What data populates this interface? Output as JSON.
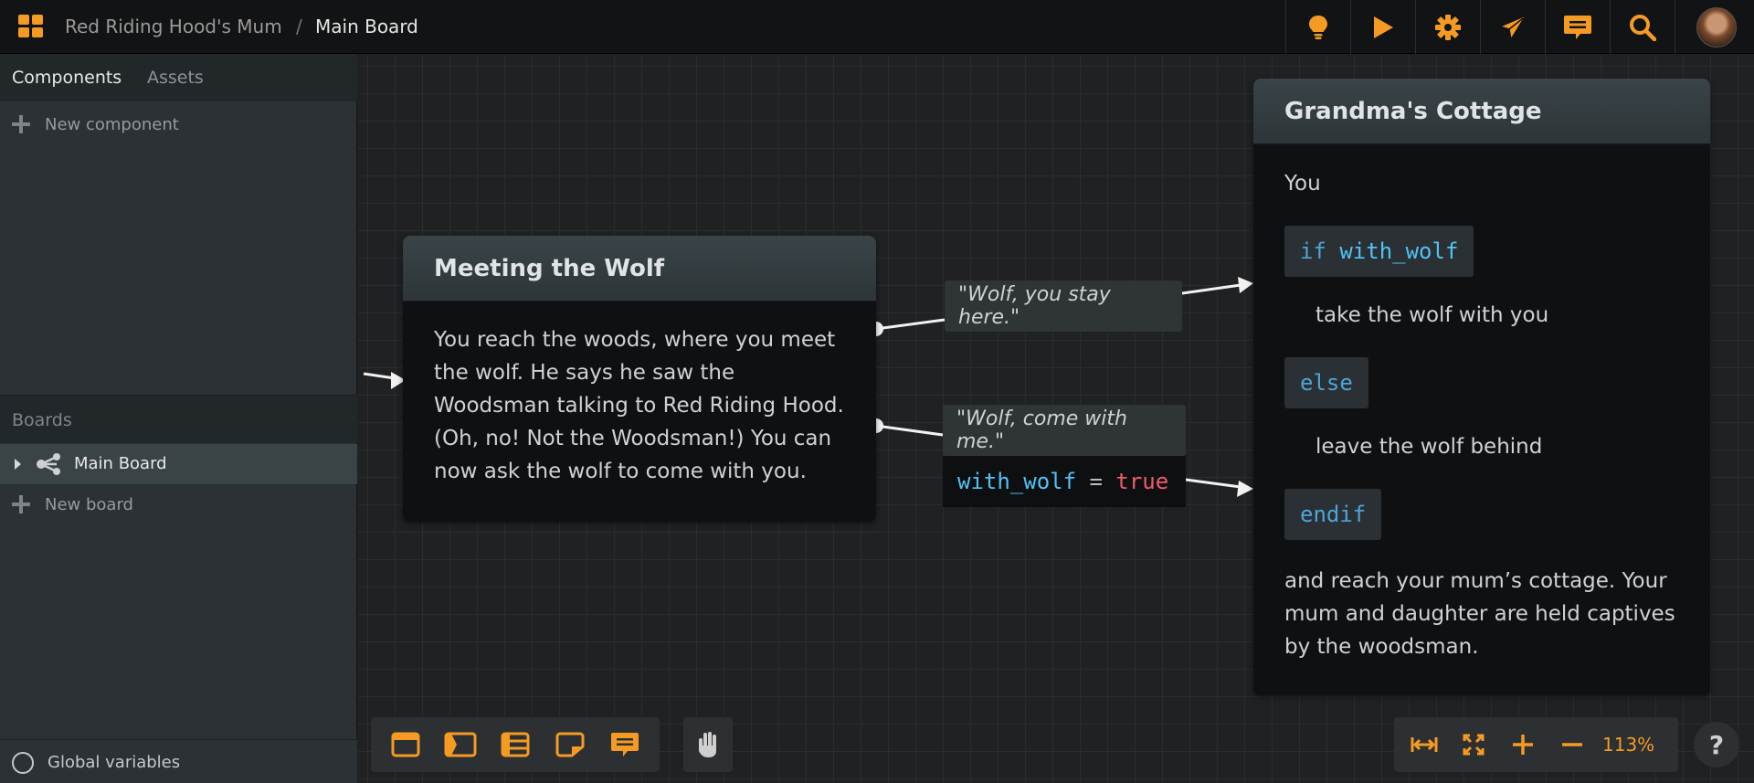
{
  "header": {
    "project": "Red Riding Hood's Mum",
    "separator": "/",
    "board": "Main Board",
    "buttons": [
      "lightbulb-icon",
      "play-icon",
      "gear-icon",
      "send-icon",
      "comment-icon",
      "search-icon"
    ]
  },
  "sidebar": {
    "tabs": [
      "Components",
      "Assets"
    ],
    "new_component": "New component",
    "boards_heading": "Boards",
    "boards": [
      {
        "label": "Main Board"
      }
    ],
    "new_board": "New board",
    "footer": "Global variables"
  },
  "canvas": {
    "nodes": {
      "meeting": {
        "title": "Meeting the Wolf",
        "lines": [
          "You reach the woods, where you meet",
          "the wolf. He says he saw the",
          "Woodsman talking to Red Riding Hood.",
          "(Oh, no! Not the Woodsman!) You can",
          "now ask the wolf to come with you."
        ]
      },
      "cottage": {
        "title": "Grandma's Cottage",
        "intro": "You",
        "if_kw": "if",
        "if_var": "with_wolf",
        "take": "take the wolf with you",
        "else_kw": "else",
        "leave": "leave the wolf behind",
        "endif_kw": "endif",
        "outro": [
          "and reach your mum’s cottage. Your",
          "mum and daughter are held captives",
          "by the woodsman."
        ]
      }
    },
    "choices": [
      {
        "label": "\"Wolf, you stay here.\""
      },
      {
        "label": "\"Wolf, come with me.\"",
        "code": {
          "var": "with_wolf",
          "op": "=",
          "value": "true"
        }
      }
    ]
  },
  "bottom_toolbar": {
    "tools": [
      "dialogue-node-icon",
      "choice-node-icon",
      "list-node-icon",
      "note-node-icon",
      "comment-node-icon"
    ],
    "hand": "hand-icon"
  },
  "zoom": {
    "label": "113%"
  },
  "help": {
    "label": "?"
  },
  "colors": {
    "accent": "#f59a23",
    "variable": "#4fc3f7",
    "literal": "#ef5b6b",
    "keyword": "#4ea4d8"
  }
}
